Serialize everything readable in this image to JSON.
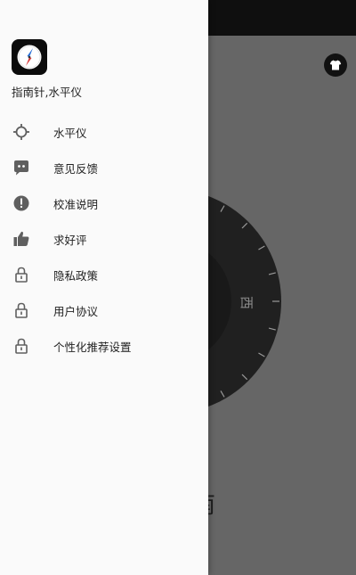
{
  "app": {
    "name": "指南针,水平仪"
  },
  "menu": {
    "items": [
      {
        "label": "水平仪",
        "icon": "crosshair-icon"
      },
      {
        "label": "意见反馈",
        "icon": "chat-bubble-icon"
      },
      {
        "label": "校准说明",
        "icon": "exclamation-circle-icon"
      },
      {
        "label": "求好评",
        "icon": "thumbs-up-icon"
      },
      {
        "label": "隐私政策",
        "icon": "lock-icon"
      },
      {
        "label": "用户协议",
        "icon": "lock-icon"
      },
      {
        "label": "个性化推荐设置",
        "icon": "lock-icon"
      }
    ]
  },
  "background": {
    "west_label": "西",
    "south_label": "南"
  },
  "colors": {
    "drawer_bg": "#fafafa",
    "icon": "#5f5f5f",
    "text": "#222222",
    "scrim": "#666666"
  }
}
